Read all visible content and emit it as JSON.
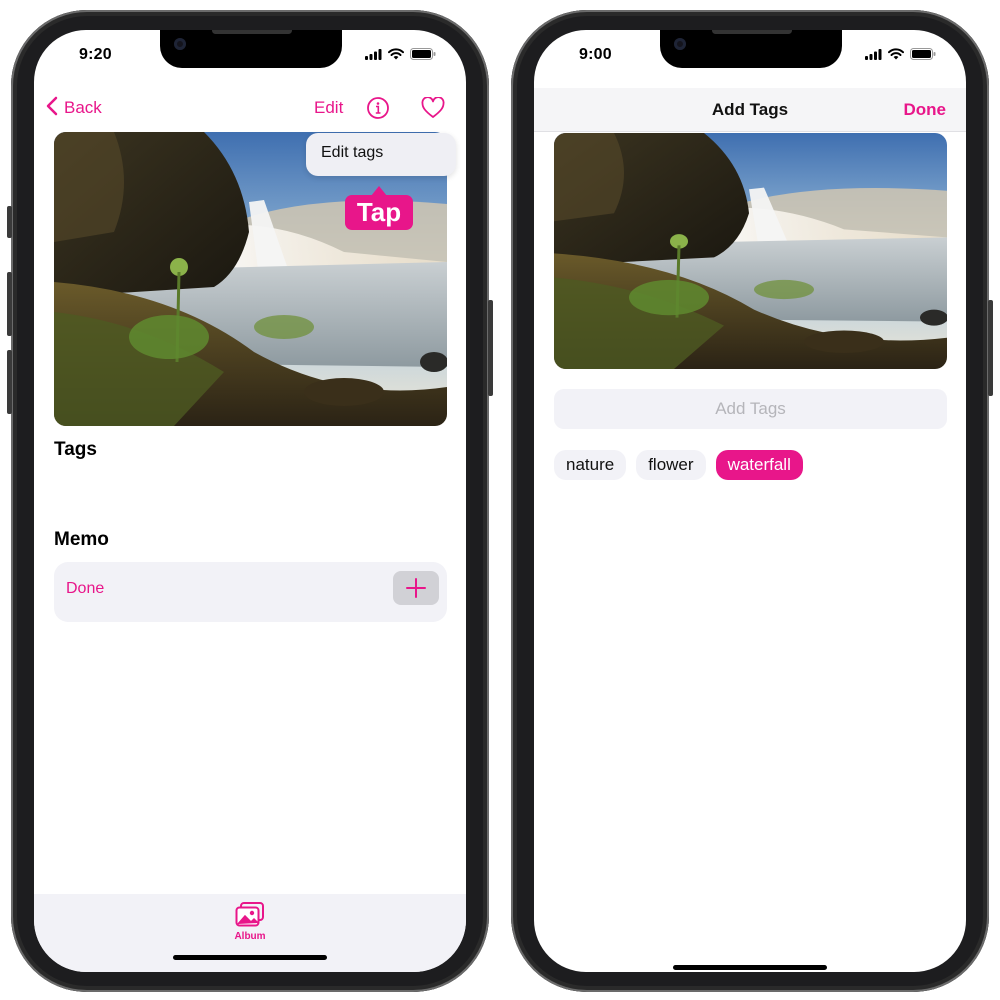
{
  "left_screen": {
    "status_time": "9:20",
    "nav": {
      "back_label": "Back",
      "edit_label": "Edit"
    },
    "context_menu": {
      "item": "Edit tags"
    },
    "callout": "Tap",
    "tags_title": "Tags",
    "memo_title": "Memo",
    "memo_done": "Done",
    "tab_album": "Album"
  },
  "right_screen": {
    "status_time": "9:00",
    "nav": {
      "title": "Add Tags",
      "done_label": "Done"
    },
    "tag_input_placeholder": "Add Tags",
    "tags": [
      {
        "label": "nature",
        "selected": false
      },
      {
        "label": "flower",
        "selected": false
      },
      {
        "label": "waterfall",
        "selected": true
      }
    ]
  },
  "colors": {
    "accent": "#e8168a",
    "field_bg": "#f2f2f7"
  }
}
